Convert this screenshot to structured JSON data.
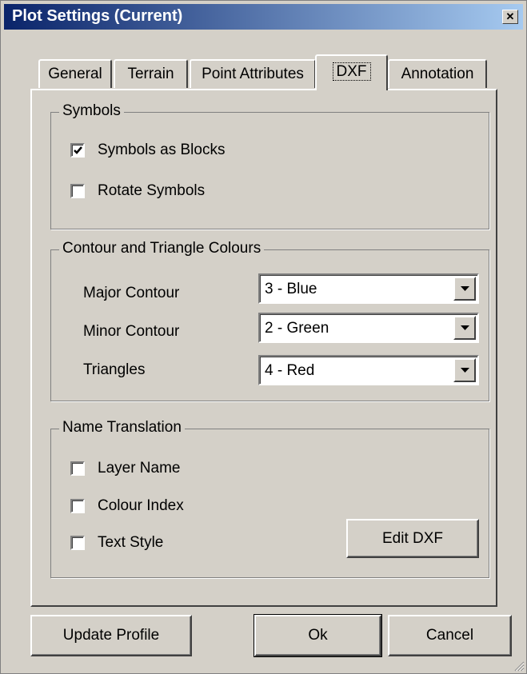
{
  "window": {
    "title": "Plot Settings  (Current)",
    "close_glyph": "✕"
  },
  "tabs": [
    {
      "label": "General",
      "active": false
    },
    {
      "label": "Terrain",
      "active": false
    },
    {
      "label": "Point Attributes",
      "active": false
    },
    {
      "label": "DXF",
      "active": true
    },
    {
      "label": "Annotation",
      "active": false
    }
  ],
  "symbols": {
    "legend": "Symbols",
    "options": [
      {
        "label": "Symbols as Blocks",
        "checked": true
      },
      {
        "label": "Rotate Symbols",
        "checked": false
      }
    ]
  },
  "colours": {
    "legend": "Contour and Triangle Colours",
    "rows": [
      {
        "label": "Major Contour",
        "value": "3 - Blue"
      },
      {
        "label": "Minor Contour",
        "value": "2 - Green"
      },
      {
        "label": "Triangles",
        "value": "4 - Red"
      }
    ]
  },
  "name_translation": {
    "legend": "Name Translation",
    "options": [
      {
        "label": "Layer Name",
        "checked": false
      },
      {
        "label": "Colour Index",
        "checked": false
      },
      {
        "label": "Text Style",
        "checked": false
      }
    ],
    "edit_button": "Edit DXF"
  },
  "buttons": {
    "update_profile": "Update Profile",
    "ok": "Ok",
    "cancel": "Cancel"
  },
  "icons": {
    "check": "check-mark-icon",
    "dropdown": "chevron-down-icon",
    "grip": "resize-grip-icon"
  },
  "colors": {
    "title_start": "#0a246a",
    "title_end": "#a6caf0",
    "face": "#d4d0c8"
  }
}
